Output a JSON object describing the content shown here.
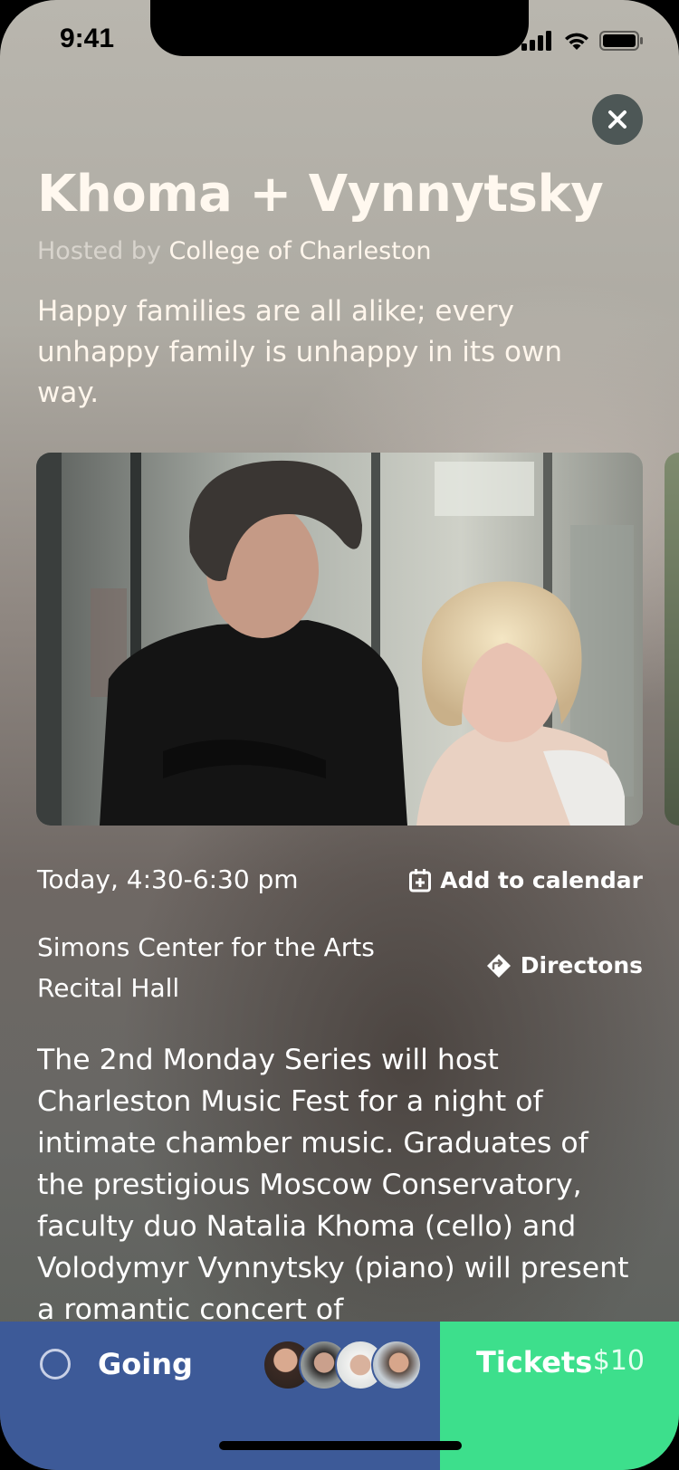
{
  "status_bar": {
    "time": "9:41"
  },
  "event": {
    "title": "Khoma + Vynnytsky",
    "hosted_prefix": "Hosted by ",
    "host": "College of Charleston",
    "tagline": "Happy families are all alike; every unhappy family is unhappy in its own way.",
    "when": "Today, 4:30-6:30 pm",
    "add_to_calendar": "Add to calendar",
    "venue_line1": "Simons Center for the Arts",
    "venue_line2": "Recital Hall",
    "directions": "Directons",
    "description": "The 2nd Monday Series will host Charleston Music Fest for a night of intimate chamber music. Graduates of the prestigious Moscow Conservatory, faculty duo Natalia Khoma (cello) and Volodymyr Vynnytsky (piano) will present a romantic concert of"
  },
  "bottom_bar": {
    "going_label": "Going",
    "tickets_label": "Tickets",
    "tickets_price": "$10"
  },
  "icons": {
    "close": "close-icon",
    "calendar": "calendar-plus-icon",
    "directions": "directions-icon",
    "signal": "cellular-signal-icon",
    "wifi": "wifi-icon",
    "battery": "battery-icon"
  },
  "colors": {
    "going_bar": "#3d5a98",
    "tickets_bar": "#3ddf8c",
    "close_button": "#4d5756"
  }
}
